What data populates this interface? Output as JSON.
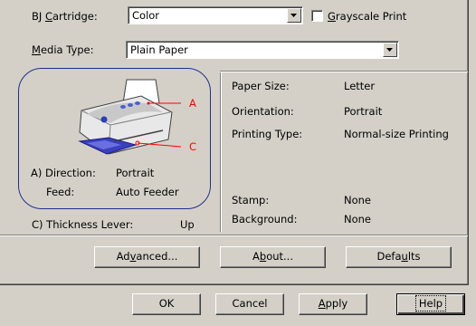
{
  "cartridge": {
    "label_pre": "BJ ",
    "label_u": "C",
    "label_post": "artridge:",
    "value": "Color"
  },
  "grayscale": {
    "label_u": "G",
    "label_post": "rayscale Print",
    "checked": false
  },
  "media": {
    "label_u": "M",
    "label_post": "edia Type:",
    "value": "Plain Paper"
  },
  "preview": {
    "callout_a": "A",
    "callout_c": "C",
    "direction_label": "A) Direction:",
    "direction_value": "Portrait",
    "feed_label": "Feed:",
    "feed_value": "Auto Feeder"
  },
  "thickness": {
    "label": "C) Thickness Lever:",
    "value": "Up"
  },
  "info": {
    "paper_size_label": "Paper Size:",
    "paper_size_value": "Letter",
    "orientation_label": "Orientation:",
    "orientation_value": "Portrait",
    "printing_type_label": "Printing Type:",
    "printing_type_value": "Normal-size Printing",
    "stamp_label": "Stamp:",
    "stamp_value": "None",
    "background_label": "Background:",
    "background_value": "None"
  },
  "buttons": {
    "advanced_pre": "Ad",
    "advanced_u": "v",
    "advanced_post": "anced...",
    "about_pre": "A",
    "about_u": "b",
    "about_post": "out...",
    "defaults_pre": "Defa",
    "defaults_u": "u",
    "defaults_post": "lts"
  },
  "dialog": {
    "ok": "OK",
    "cancel": "Cancel",
    "apply_u": "A",
    "apply_post": "pply",
    "help": "Help"
  },
  "colors": {
    "face": "#d4d0c8",
    "callout": "#ff0000",
    "preview_border": "#1f2f8f"
  }
}
